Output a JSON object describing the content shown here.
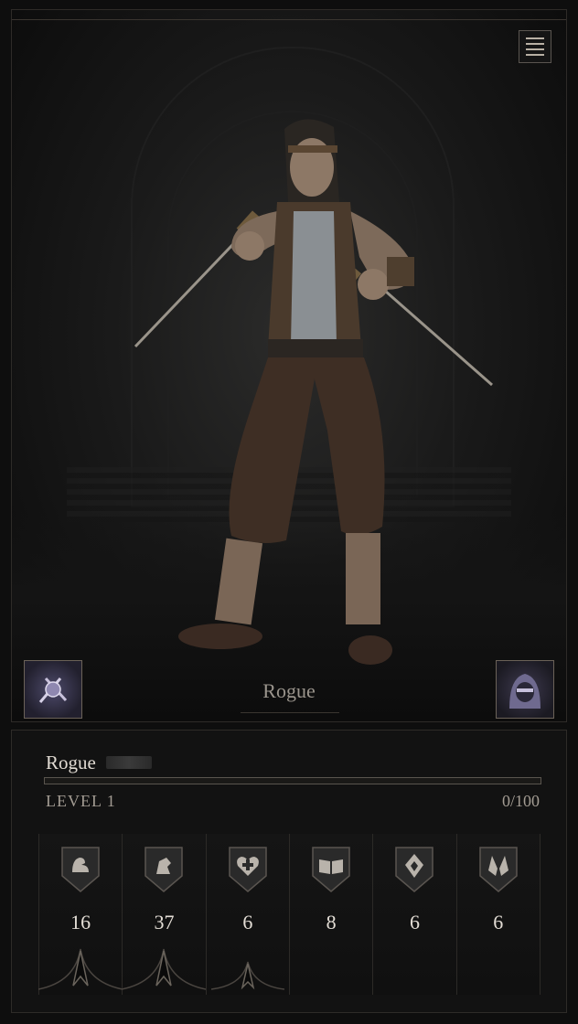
{
  "portrait": {
    "class_name": "Rogue",
    "menu_icon": "list-menu-icon",
    "class_icon": "rogue-class-emblem-icon",
    "cosmetic_icon": "hooded-rogue-cosmetic-icon"
  },
  "character": {
    "name": "Rogue",
    "level_label": "LEVEL 1",
    "xp_text": "0/100",
    "xp_progress": 0
  },
  "stats": [
    {
      "icon": "strength-arm-icon",
      "value": "16",
      "rank": true
    },
    {
      "icon": "dexterity-fist-icon",
      "value": "37",
      "rank": true
    },
    {
      "icon": "constitution-heart-icon",
      "value": "6",
      "rank": true
    },
    {
      "icon": "intelligence-book-icon",
      "value": "8",
      "rank": false
    },
    {
      "icon": "willpower-spirit-icon",
      "value": "6",
      "rank": false
    },
    {
      "icon": "faith-praying-hands-icon",
      "value": "6",
      "rank": false
    }
  ],
  "colors": {
    "accent": "#8a6a3a",
    "panel": "#121212",
    "text": "#e0dad2"
  }
}
